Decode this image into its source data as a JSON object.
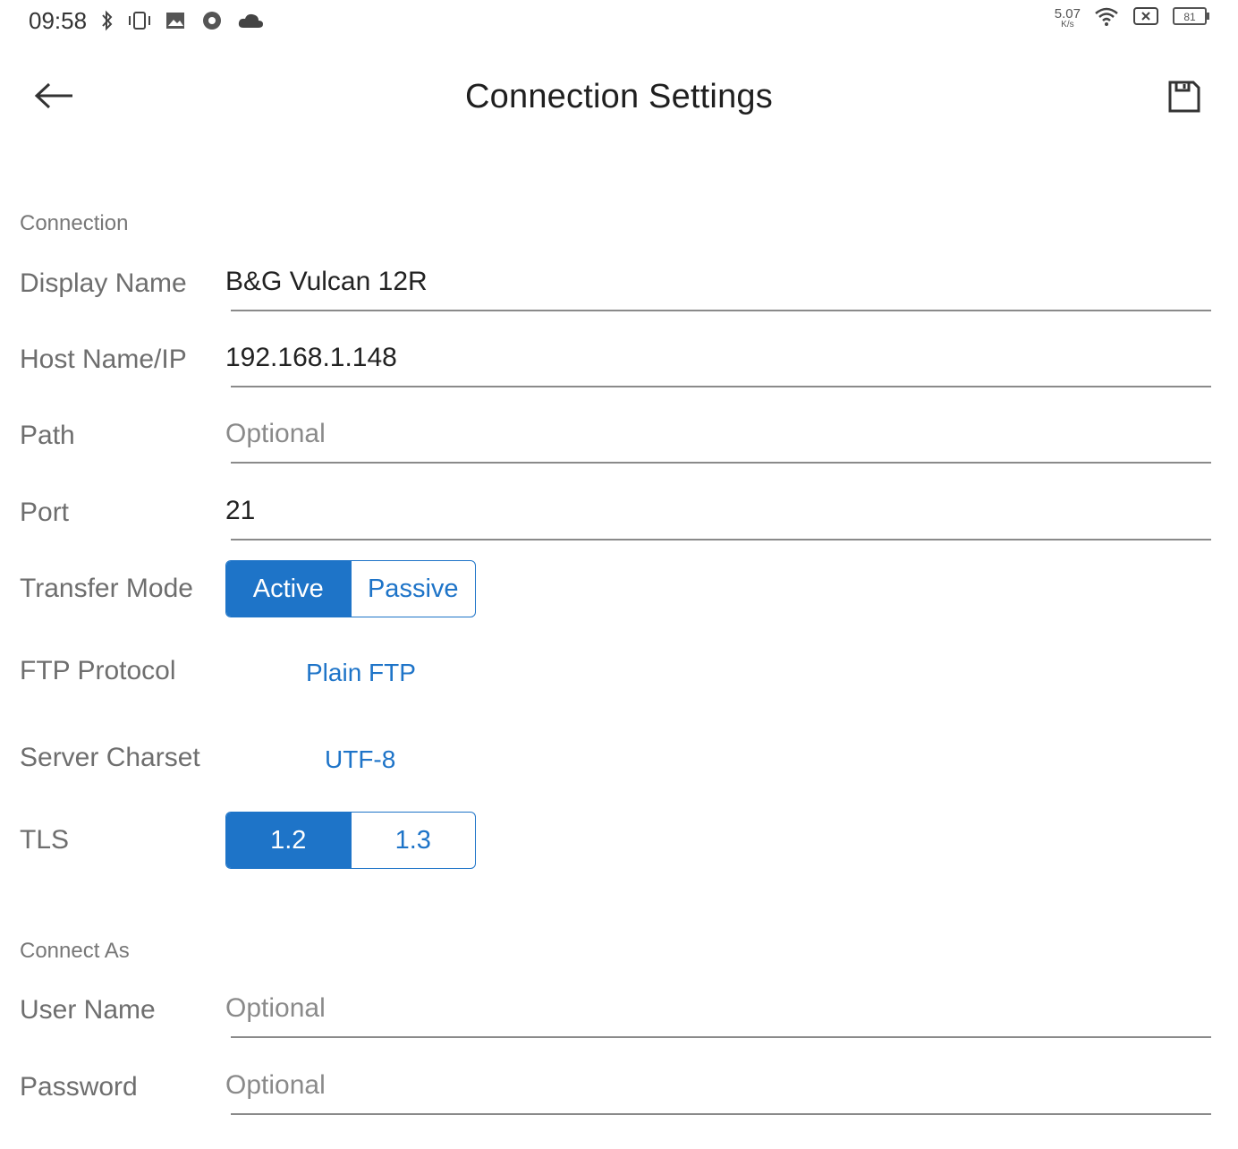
{
  "status_bar": {
    "time": "09:58",
    "net_speed_value": "5.07",
    "net_speed_unit": "K/s",
    "battery": "81",
    "icons_left": [
      "bluetooth-icon",
      "vibrate-icon",
      "gallery-icon",
      "chrome-icon",
      "cloud-icon"
    ],
    "icons_right": [
      "wifi-icon",
      "sim-none-icon",
      "battery-icon"
    ]
  },
  "app_bar": {
    "title": "Connection Settings",
    "back_icon": "arrow-back-icon",
    "save_icon": "save-icon"
  },
  "connection": {
    "section_label": "Connection",
    "display_name": {
      "label": "Display Name",
      "value": "B&G Vulcan 12R"
    },
    "host": {
      "label": "Host Name/IP",
      "value": "192.168.1.148"
    },
    "path": {
      "label": "Path",
      "value": "",
      "placeholder": "Optional"
    },
    "port": {
      "label": "Port",
      "value": "21"
    },
    "transfer_mode": {
      "label": "Transfer Mode",
      "options": [
        "Active",
        "Passive"
      ],
      "selected": "Active"
    },
    "ftp_protocol": {
      "label": "FTP Protocol",
      "value": "Plain FTP"
    },
    "server_charset": {
      "label": "Server Charset",
      "value": "UTF-8"
    },
    "tls": {
      "label": "TLS",
      "options": [
        "1.2",
        "1.3"
      ],
      "selected": "1.2"
    }
  },
  "connect_as": {
    "section_label": "Connect As",
    "user_name": {
      "label": "User Name",
      "value": "",
      "placeholder": "Optional"
    },
    "password": {
      "label": "Password",
      "value": "",
      "placeholder": "Optional"
    }
  },
  "colors": {
    "accent": "#1e74c8",
    "label_gray": "#6e6e6e",
    "underline": "#8a8a8a"
  }
}
